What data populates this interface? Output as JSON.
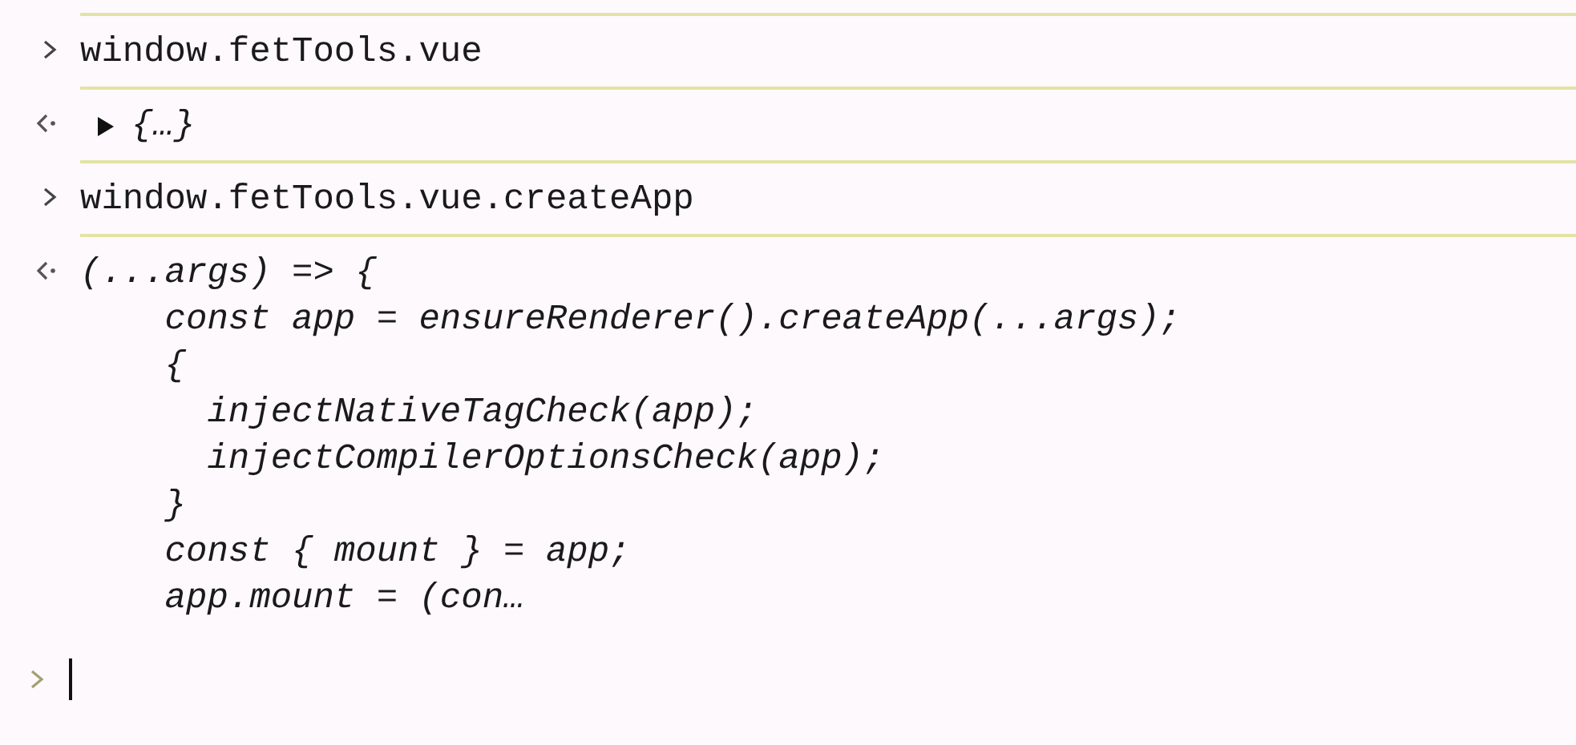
{
  "entries": [
    {
      "kind": "input",
      "text": "window.fetTools.vue"
    },
    {
      "kind": "result",
      "expanded": false,
      "text": "{…}"
    },
    {
      "kind": "input",
      "text": "window.fetTools.vue.createApp"
    },
    {
      "kind": "code",
      "lines": [
        "(...args) => {",
        "    const app = ensureRenderer().createApp(...args);",
        "    {",
        "      injectNativeTagCheck(app);",
        "      injectCompilerOptionsCheck(app);",
        "    }",
        "    const { mount } = app;",
        "    app.mount = (con…"
      ]
    }
  ]
}
